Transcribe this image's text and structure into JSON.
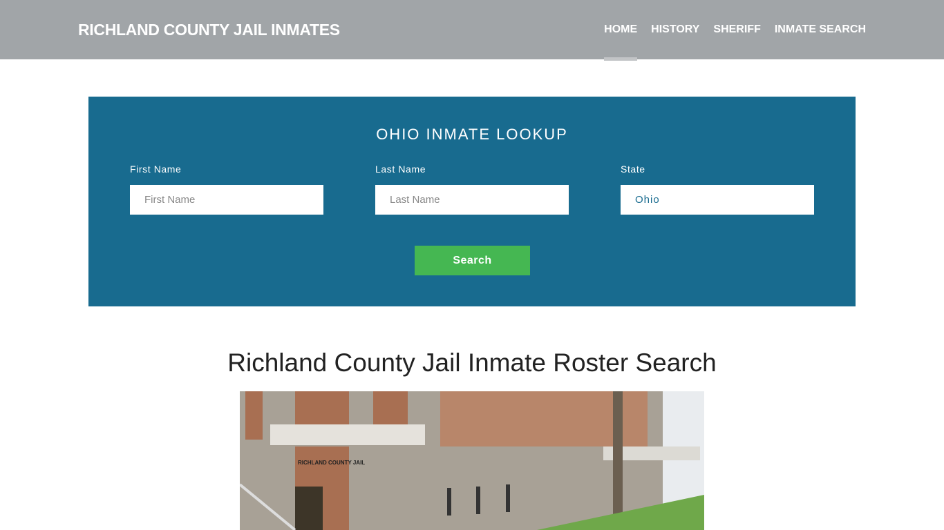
{
  "header": {
    "brand": "RICHLAND COUNTY JAIL INMATES",
    "nav": [
      {
        "label": "HOME",
        "active": true
      },
      {
        "label": "HISTORY"
      },
      {
        "label": "SHERIFF"
      },
      {
        "label": "INMATE SEARCH"
      }
    ]
  },
  "lookup": {
    "title": "OHIO INMATE LOOKUP",
    "first": {
      "label": "First Name",
      "placeholder": "First Name",
      "value": ""
    },
    "last": {
      "label": "Last Name",
      "placeholder": "Last Name",
      "value": ""
    },
    "state": {
      "label": "State",
      "value": "Ohio"
    },
    "search_label": "Search"
  },
  "main": {
    "title": "Richland County Jail Inmate Roster Search",
    "photo_sign": "RICHLAND COUNTY JAIL"
  },
  "colors": {
    "header": "#a1a5a8",
    "panel": "#186b8f",
    "button": "#45b752"
  }
}
